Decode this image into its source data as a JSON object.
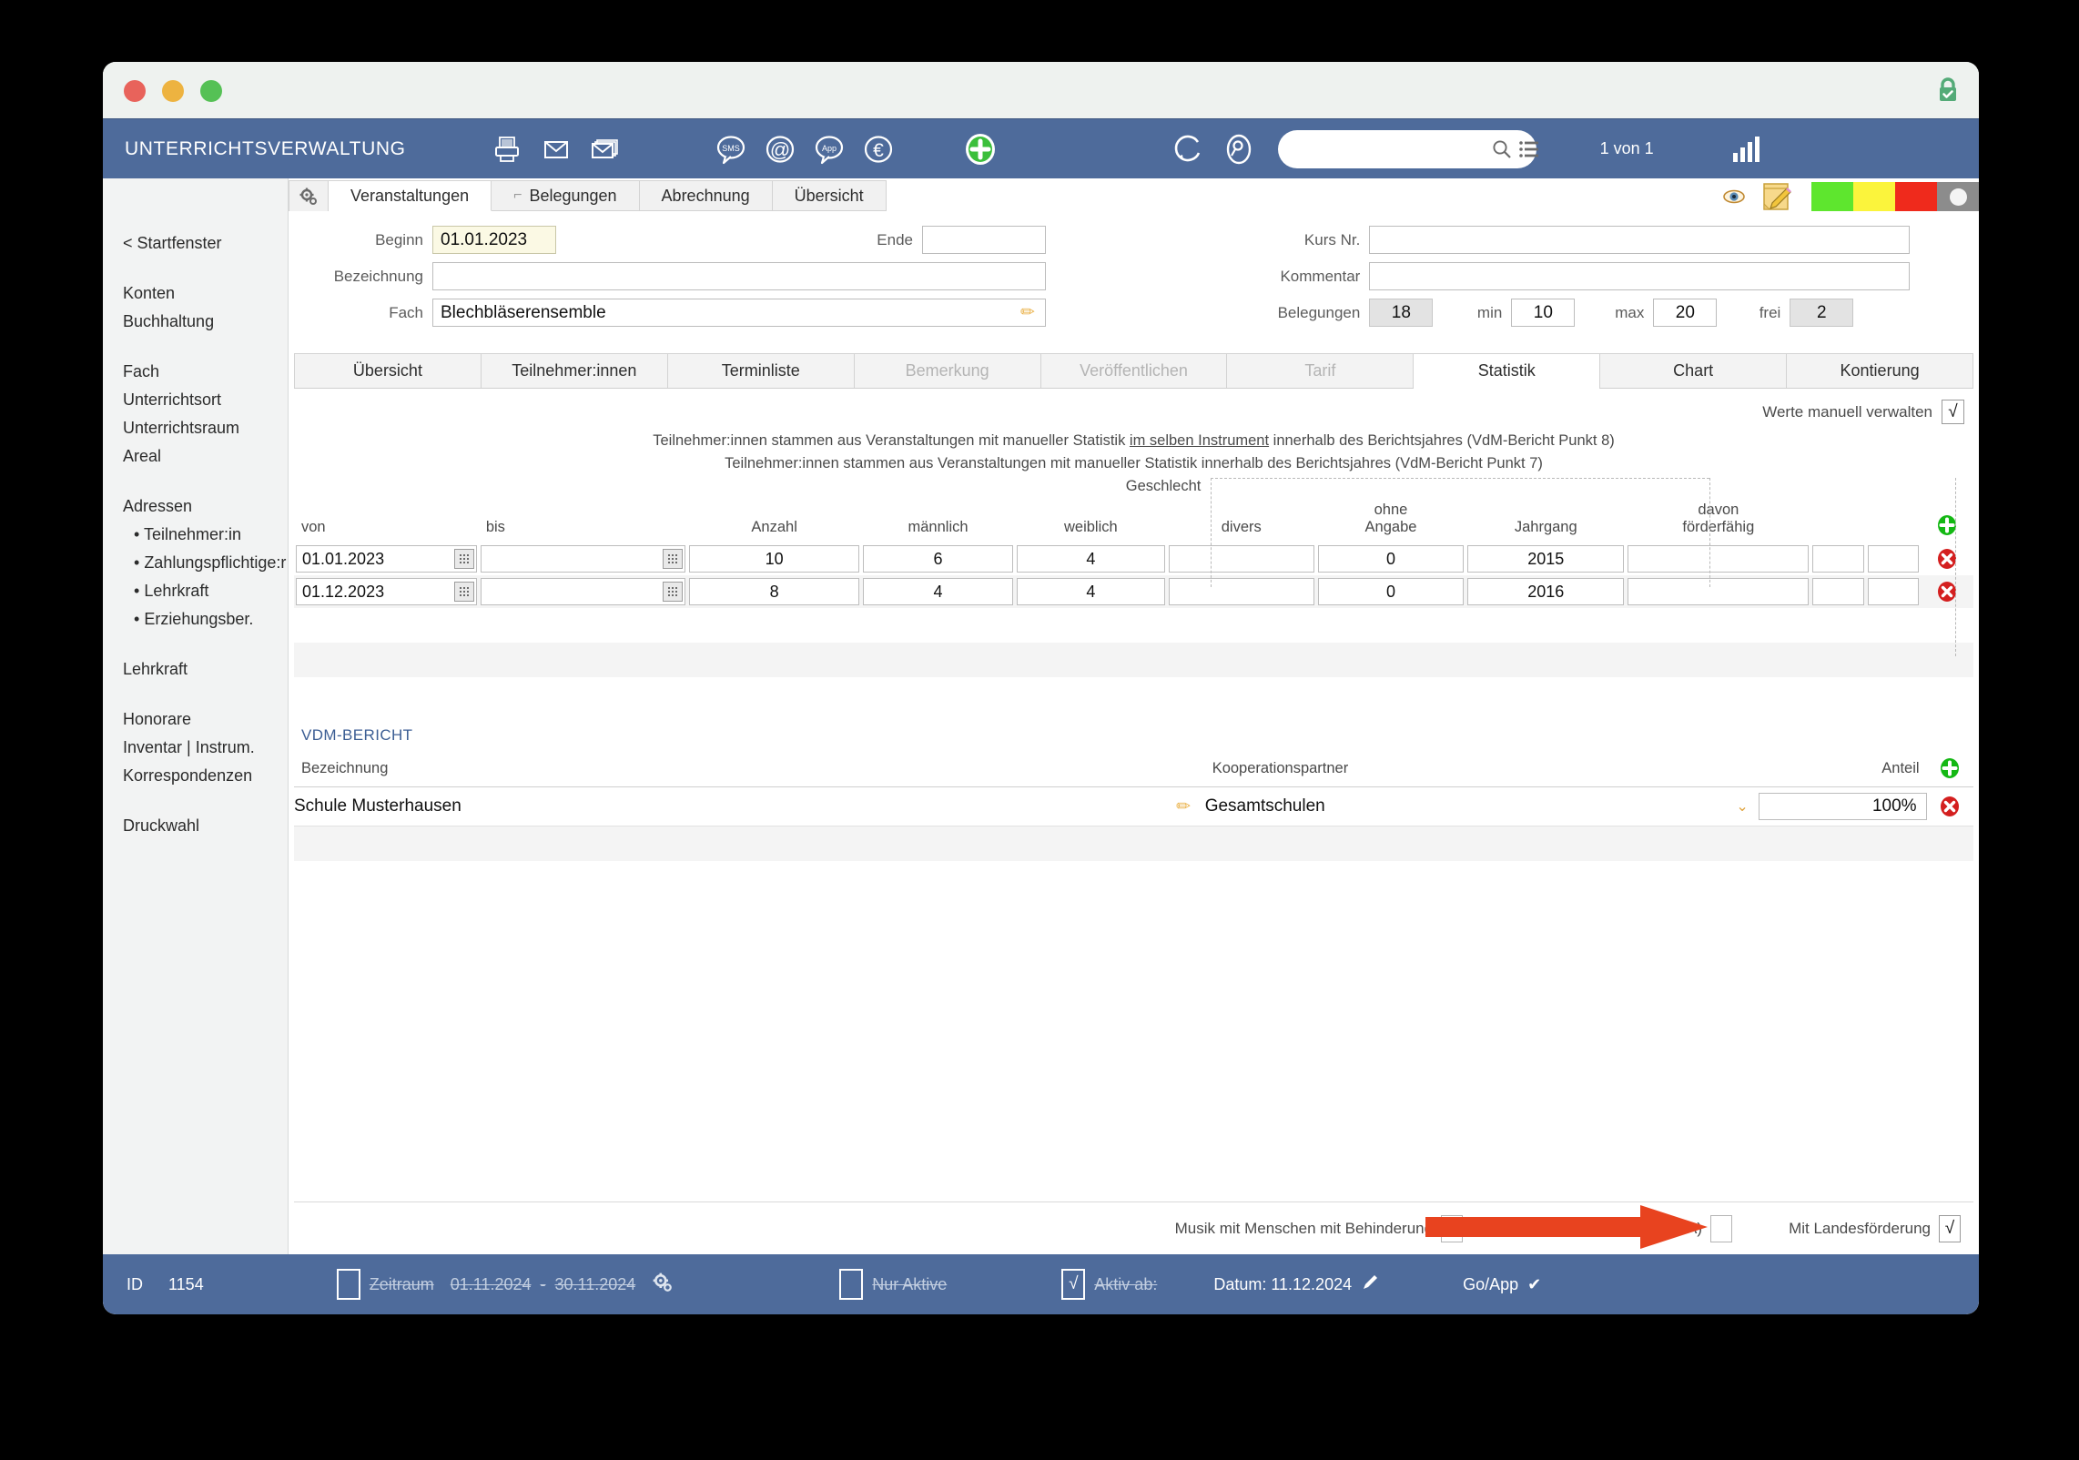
{
  "window": {
    "traffic_lights": [
      "close",
      "minimize",
      "zoom"
    ],
    "lock_icon": "lock-secure-icon"
  },
  "appbar": {
    "title": "UNTERRICHTSVERWALTUNG",
    "icons": [
      {
        "name": "print-icon",
        "label": "Drucken"
      },
      {
        "name": "mail-icon",
        "label": "E-Mail"
      },
      {
        "name": "mail-multiple-icon",
        "label": "Serienmail"
      },
      {
        "name": "sms-bubble-icon",
        "label": "SMS"
      },
      {
        "name": "at-sign-icon",
        "label": "@"
      },
      {
        "name": "app-bubble-icon",
        "label": "App"
      },
      {
        "name": "euro-icon",
        "label": "€"
      },
      {
        "name": "add-plus-icon",
        "label": "Neu"
      }
    ],
    "right_icons": [
      {
        "name": "refresh-icon",
        "label": "Aktualisieren"
      },
      {
        "name": "find-icon",
        "label": "Suchen"
      }
    ],
    "search": {
      "value": "",
      "placeholder": ""
    },
    "search_icons": [
      "search-icon",
      "list-icon"
    ],
    "page_count": "1 von 1",
    "signal_icon": "signal-bars-icon"
  },
  "sidebar": {
    "back_label": "< Startfenster",
    "groups": [
      {
        "items": [
          {
            "label": "Konten"
          },
          {
            "label": "Buchhaltung"
          }
        ]
      },
      {
        "items": [
          {
            "label": "Fach"
          },
          {
            "label": "Unterrichtsort"
          },
          {
            "label": "Unterrichtsraum"
          },
          {
            "label": "Areal"
          }
        ]
      },
      {
        "items": [
          {
            "label": "Adressen"
          },
          {
            "label": "Teilnehmer:in",
            "sub": true
          },
          {
            "label": "Zahlungspflichtige:r",
            "sub": true
          },
          {
            "label": "Lehrkraft",
            "sub": true
          },
          {
            "label": "Erziehungsber.",
            "sub": true
          }
        ]
      },
      {
        "items": [
          {
            "label": "Lehrkraft"
          }
        ]
      },
      {
        "items": [
          {
            "label": "Honorare"
          },
          {
            "label": "Inventar | Instrum."
          },
          {
            "label": "Korrespondenzen"
          }
        ]
      },
      {
        "items": [
          {
            "label": "Druckwahl"
          }
        ]
      }
    ]
  },
  "top_tabs": {
    "gear_icon": "gear-icon",
    "items": [
      {
        "label": "Veranstaltungen",
        "active": true,
        "hook": false
      },
      {
        "label": "Belegungen",
        "active": false,
        "hook": true
      },
      {
        "label": "Abrechnung",
        "active": false,
        "hook": false
      },
      {
        "label": "Übersicht",
        "active": false,
        "hook": false
      }
    ]
  },
  "status_icons": {
    "eye_icon": "eye-icon",
    "note_icon": "note-edit-icon",
    "swatches": [
      "#5ee62e",
      "#fbf43c",
      "#ef2a1c",
      "#8c8c8c"
    ]
  },
  "header_form": {
    "beginn": {
      "label": "Beginn",
      "value": "01.01.2023"
    },
    "ende": {
      "label": "Ende",
      "value": ""
    },
    "bezeichnung": {
      "label": "Bezeichnung",
      "value": ""
    },
    "fach": {
      "label": "Fach",
      "value": "Blechbläserensemble"
    },
    "kurs_nr": {
      "label": "Kurs Nr.",
      "value": ""
    },
    "kommentar": {
      "label": "Kommentar",
      "value": ""
    },
    "belegungen": {
      "label": "Belegungen",
      "value": "18"
    },
    "min": {
      "label": "min",
      "value": "10"
    },
    "max": {
      "label": "max",
      "value": "20"
    },
    "frei": {
      "label": "frei",
      "value": "2"
    }
  },
  "sub_tabs": [
    {
      "label": "Übersicht",
      "state": "normal"
    },
    {
      "label": "Teilnehmer:innen",
      "state": "normal"
    },
    {
      "label": "Terminliste",
      "state": "normal"
    },
    {
      "label": "Bemerkung",
      "state": "disabled"
    },
    {
      "label": "Veröffentlichen",
      "state": "disabled"
    },
    {
      "label": "Tarif",
      "state": "disabled"
    },
    {
      "label": "Statistik",
      "state": "active"
    },
    {
      "label": "Chart",
      "state": "normal"
    },
    {
      "label": "Kontierung",
      "state": "normal"
    }
  ],
  "statistik": {
    "manual_label": "Werte manuell verwalten",
    "manual_checked": "√",
    "note_1_pre": "Teilnehmer:innen stammen aus Veranstaltungen mit manueller Statistik ",
    "note_1_underline": "im selben Instrument",
    "note_1_post": " innerhalb des Berichtsjahres (VdM-Bericht Punkt 8)",
    "note_2": "Teilnehmer:innen stammen aus Veranstaltungen mit manueller Statistik innerhalb des Berichtsjahres (VdM-Bericht Punkt 7)",
    "group_header": "Geschlecht",
    "columns": {
      "von": "von",
      "bis": "bis",
      "anzahl": "Anzahl",
      "maennlich": "männlich",
      "weiblich": "weiblich",
      "divers": "divers",
      "ohne_angabe": "ohne\nAngabe",
      "ohne_angabe_l1": "ohne",
      "ohne_angabe_l2": "Angabe",
      "jahrgang": "Jahrgang",
      "davon_l1": "davon",
      "davon_l2": "förderfähig"
    },
    "add_icon": "add-row-icon",
    "delete_icon": "delete-row-icon",
    "rows": [
      {
        "von": "01.01.2023",
        "bis": "",
        "anzahl": "10",
        "maennlich": "6",
        "weiblich": "4",
        "divers": "",
        "ohne_angabe": "0",
        "jahrgang": "2015",
        "foerderfaehig": "",
        "x1": "",
        "x2": ""
      },
      {
        "von": "01.12.2023",
        "bis": "",
        "anzahl": "8",
        "maennlich": "4",
        "weiblich": "4",
        "divers": "",
        "ohne_angabe": "0",
        "jahrgang": "2016",
        "foerderfaehig": "",
        "x1": "",
        "x2": ""
      }
    ]
  },
  "vdm": {
    "title": "VDM-BERICHT",
    "columns": {
      "bezeichnung": "Bezeichnung",
      "partner": "Kooperationspartner",
      "anteil": "Anteil"
    },
    "add_icon": "add-row-icon",
    "delete_icon": "delete-row-icon",
    "rows": [
      {
        "bezeichnung": "Schule Musterhausen",
        "partner": "Gesamtschulen",
        "anteil": "100%"
      }
    ]
  },
  "bottom_checks": [
    {
      "label": "Musik mit Menschen mit Behinderung",
      "checked": ""
    },
    {
      "label": "Studienvorbereitung (SVA)",
      "checked": ""
    },
    {
      "label": "Mit Landesförderung",
      "checked": "√"
    }
  ],
  "annotation": {
    "arrow_color": "#e8431f",
    "name": "red-arrow-pointing-right"
  },
  "statusbar": {
    "id_label": "ID",
    "id_value": "1154",
    "zeitraum_label": "Zeitraum",
    "zeitraum_from": "01.11.2024",
    "zeitraum_sep": "-",
    "zeitraum_to": "30.11.2024",
    "gear_icon": "gear-icon",
    "nur_aktive_label": "Nur Aktive",
    "nur_aktive_checked": "",
    "aktiv_ab_label": "Aktiv ab:",
    "aktiv_ab_checked": "√",
    "datum_label": "Datum: 11.12.2024",
    "pencil_icon": "pencil-icon",
    "goapp_label": "Go/App",
    "goapp_check": "✔"
  }
}
